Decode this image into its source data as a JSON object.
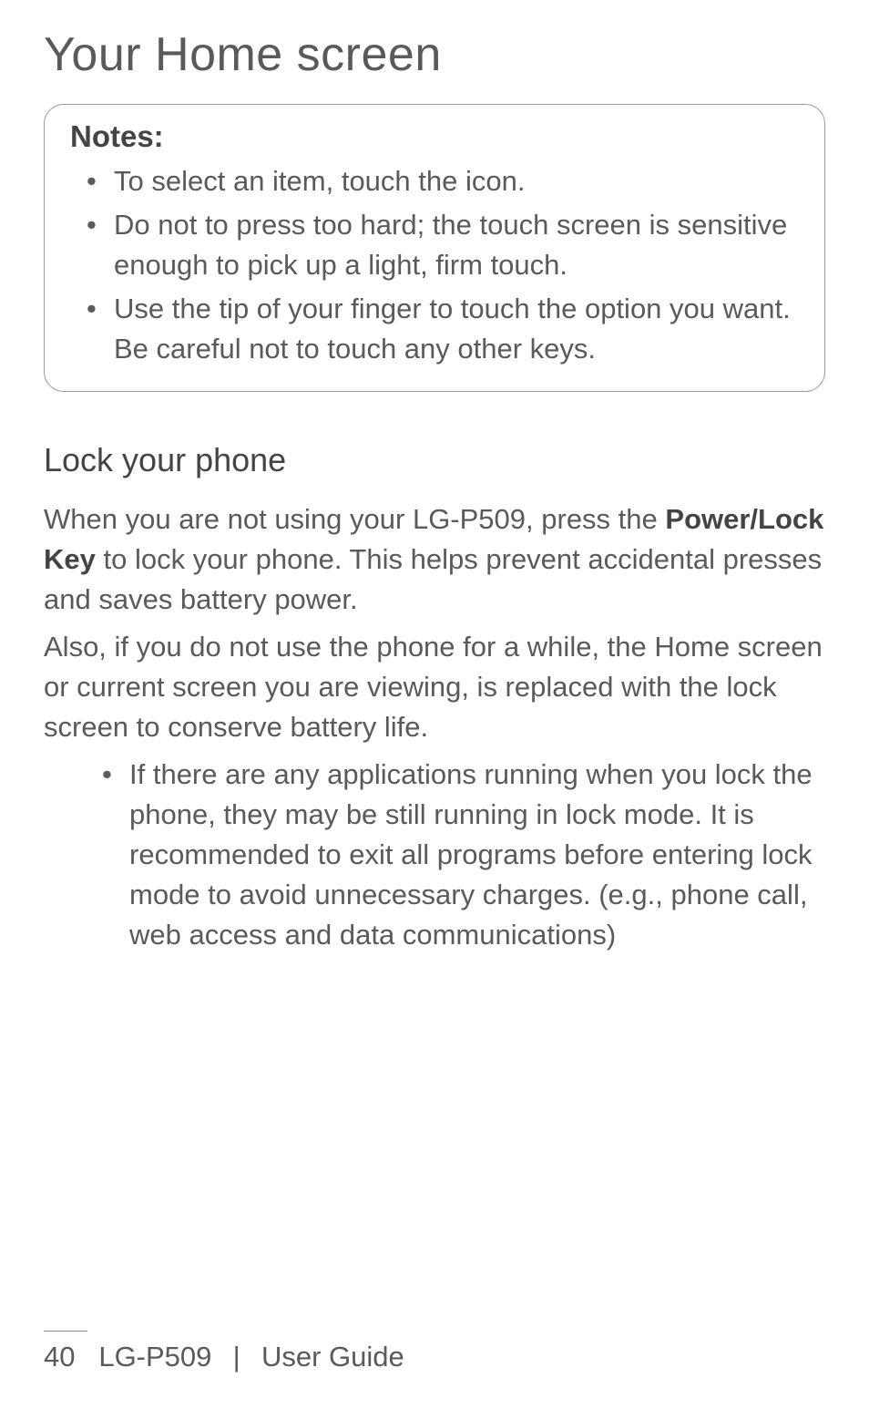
{
  "page_title": "Your Home screen",
  "notes": {
    "heading": "Notes:",
    "items": [
      "To select an item, touch the icon.",
      "Do not to press too hard; the touch screen is sensitive enough to pick up a light, firm touch.",
      "Use the tip of your finger to touch the option you want. Be careful not to touch any other keys."
    ]
  },
  "section": {
    "heading": "Lock your phone",
    "para1_pre": "When you are not using your LG-P509, press the ",
    "para1_bold": "Power/Lock Key",
    "para1_post": " to lock your phone. This helps prevent accidental presses and saves battery power.",
    "para2": "Also, if you do not use the phone for a while, the Home screen or current screen you are viewing, is replaced with the lock screen to conserve battery life.",
    "bullets": [
      "If there are any applications running when you lock the phone, they may be still running in lock mode. It is recommended to exit all programs before entering lock mode to avoid unnecessary charges. (e.g., phone call, web access and data communications)"
    ]
  },
  "footer": {
    "page_number": "40",
    "product": "LG-P509",
    "separator": "|",
    "doc_label": "User Guide"
  }
}
